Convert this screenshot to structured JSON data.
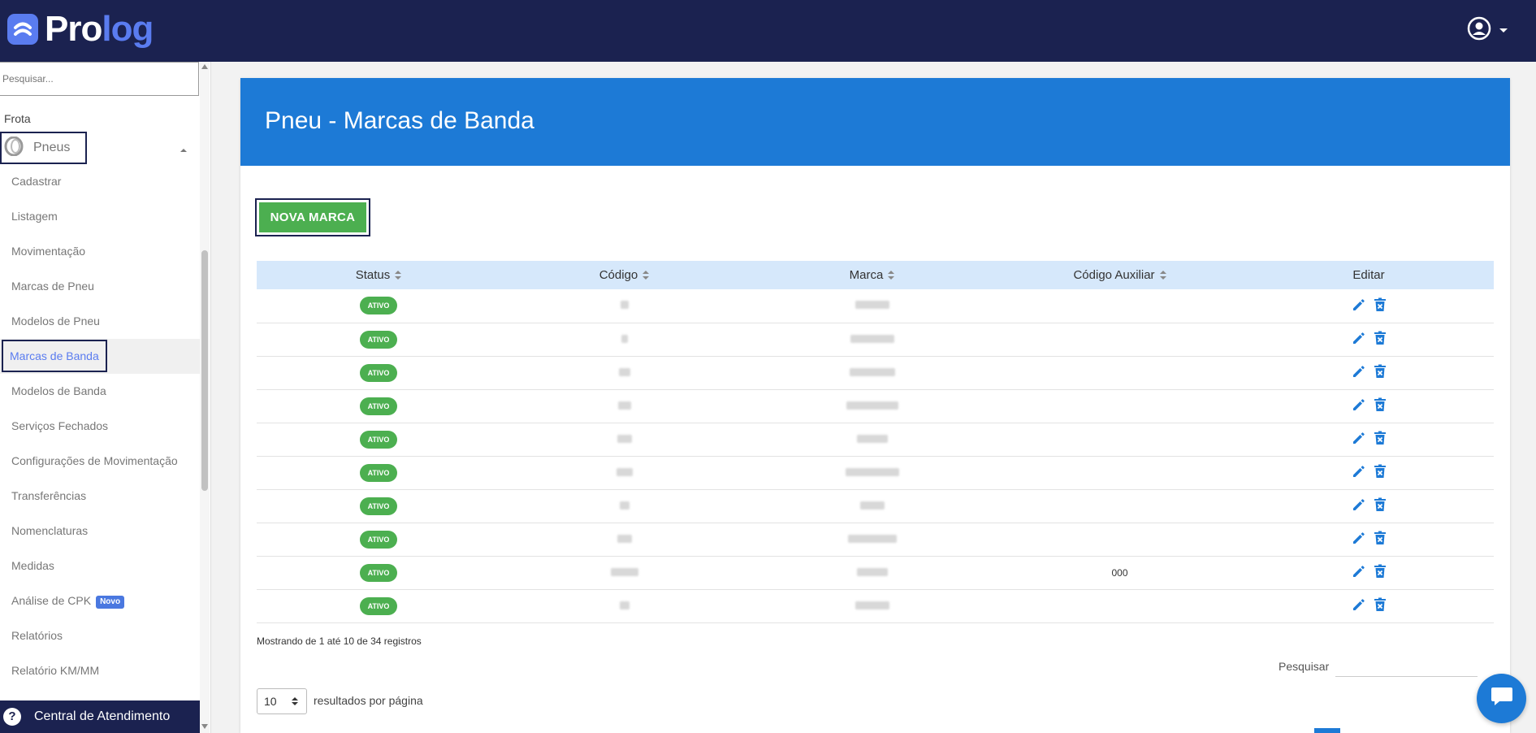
{
  "app": {
    "logo_prefix": "Pro",
    "logo_suffix": "log",
    "brand_color": "#5a7cf0",
    "header_color": "#1b2250",
    "accent_color": "#1d7ad6"
  },
  "sidebar": {
    "search_placeholder": "Pesquisar...",
    "section_label": "Frota",
    "group_label": "Pneus",
    "items": [
      {
        "label": "Cadastrar"
      },
      {
        "label": "Listagem"
      },
      {
        "label": "Movimentação"
      },
      {
        "label": "Marcas de Pneu"
      },
      {
        "label": "Modelos de Pneu"
      },
      {
        "label": "Marcas de Banda",
        "active": true
      },
      {
        "label": "Modelos de Banda"
      },
      {
        "label": "Serviços Fechados"
      },
      {
        "label": "Configurações de Movimentação"
      },
      {
        "label": "Transferências"
      },
      {
        "label": "Nomenclaturas"
      },
      {
        "label": "Medidas"
      },
      {
        "label": "Análise de CPK",
        "badge": "Novo"
      },
      {
        "label": "Relatórios"
      },
      {
        "label": "Relatório KM/MM"
      }
    ],
    "help_label": "Central de Atendimento"
  },
  "page": {
    "title": "Pneu - Marcas de Banda",
    "new_button": "NOVA MARCA"
  },
  "table": {
    "columns": [
      "Status",
      "Código",
      "Marca",
      "Código Auxiliar",
      "Editar"
    ],
    "rows": [
      {
        "status": "ATIVO",
        "codigo_auxiliar": ""
      },
      {
        "status": "ATIVO",
        "codigo_auxiliar": ""
      },
      {
        "status": "ATIVO",
        "codigo_auxiliar": ""
      },
      {
        "status": "ATIVO",
        "codigo_auxiliar": ""
      },
      {
        "status": "ATIVO",
        "codigo_auxiliar": ""
      },
      {
        "status": "ATIVO",
        "codigo_auxiliar": ""
      },
      {
        "status": "ATIVO",
        "codigo_auxiliar": ""
      },
      {
        "status": "ATIVO",
        "codigo_auxiliar": ""
      },
      {
        "status": "ATIVO",
        "codigo_auxiliar": "000"
      },
      {
        "status": "ATIVO",
        "codigo_auxiliar": ""
      }
    ]
  },
  "footer": {
    "info": "Mostrando de 1 até 10 de 34 registros",
    "search_label": "Pesquisar",
    "page_length": "10",
    "page_length_label": "resultados por página"
  },
  "icons": {
    "edit": "pencil-icon",
    "delete": "trash-x-icon",
    "user": "user-circle-icon",
    "help": "question-circle-icon",
    "chat": "chat-bubble-icon"
  }
}
